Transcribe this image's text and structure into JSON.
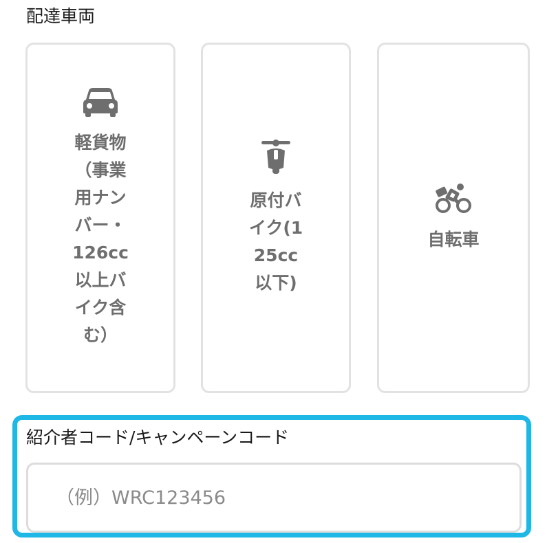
{
  "delivery_vehicle": {
    "label": "配達車両",
    "options": [
      {
        "icon": "car-icon",
        "label": "軽貨物（事業用ナンバー・126cc以上バイク含む）"
      },
      {
        "icon": "scooter-icon",
        "label": "原付バイク(125cc以下)"
      },
      {
        "icon": "bicycle-icon",
        "label": "自転車"
      }
    ]
  },
  "referral": {
    "label": "紹介者コード/キャンペーンコード",
    "value": "",
    "placeholder": "（例）WRC123456"
  },
  "colors": {
    "focus_border": "#1fb8e6",
    "card_border": "#e2e2e2",
    "icon_gray": "#6e6e6e"
  }
}
